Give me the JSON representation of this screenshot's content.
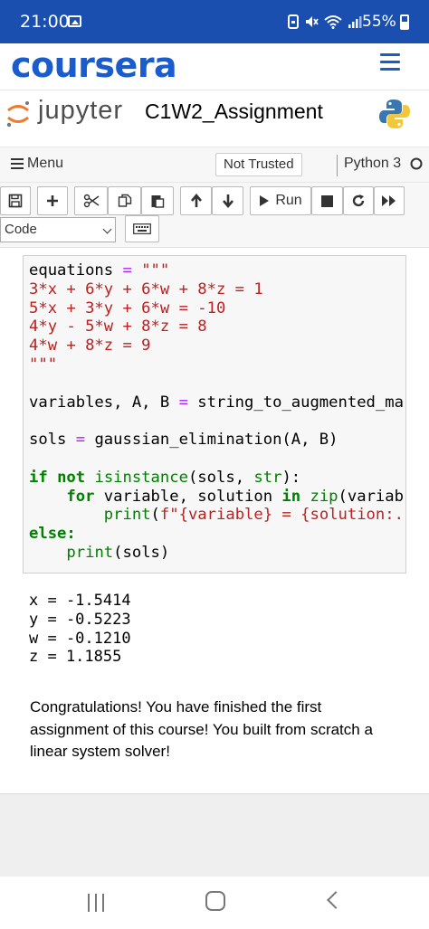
{
  "status_bar": {
    "time": "21:00",
    "battery": "55%"
  },
  "coursera": {
    "logo": "coursera"
  },
  "jupyter": {
    "wordmark": "jupyter",
    "notebook_name": "C1W2_Assignment"
  },
  "menubar": {
    "menu_label": "Menu",
    "trust": "Not Trusted",
    "kernel": "Python 3"
  },
  "toolbar": {
    "run_label": "Run",
    "cell_type": "Code"
  },
  "code_cell": {
    "lines": [
      "equations = \"\"\"",
      "3*x + 6*y + 6*w + 8*z = 1",
      "5*x + 3*y + 6*w = -10",
      "4*y - 5*w + 8*z = 8",
      "4*w + 8*z = 9",
      "\"\"\"",
      "",
      "variables, A, B = string_to_augmented_ma",
      "",
      "sols = gaussian_elimination(A, B)",
      "",
      "if not isinstance(sols, str):",
      "    for variable, solution in zip(variab",
      "        print(f\"{variable} = {solution:.",
      "else:",
      "    print(sols)"
    ]
  },
  "output": {
    "lines": [
      "x = -1.5414",
      "y = -0.5223",
      "w = -0.1210",
      "z = 1.1855"
    ]
  },
  "markdown": {
    "text": "Congratulations! You have finished the first assignment of this course! You built from scratch a linear system solver!"
  },
  "colors": {
    "status_bar": "#1a4fb0",
    "coursera_blue": "#1a5ccc",
    "keyword": "#008000",
    "operator": "#aa22ff",
    "string": "#ba2121"
  },
  "icons": [
    "gallery-icon",
    "dnd-icon",
    "mute-icon",
    "wifi-icon",
    "signal-icon",
    "battery-icon",
    "hamburger-icon",
    "python-icon",
    "save-icon",
    "plus-icon",
    "cut-icon",
    "copy-icon",
    "paste-icon",
    "arrow-up-icon",
    "arrow-down-icon",
    "play-icon",
    "stop-icon",
    "restart-icon",
    "fast-forward-icon",
    "keyboard-icon"
  ]
}
